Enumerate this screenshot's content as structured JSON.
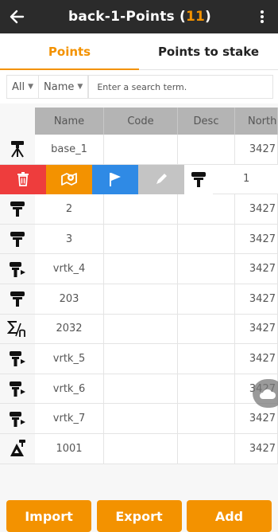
{
  "header": {
    "title": "back-1-Points",
    "count_open": " (",
    "count": "11",
    "count_close": ")",
    "back_icon": "arrow-left-icon",
    "menu_icon": "more-vertical-icon"
  },
  "tabs": [
    {
      "label": "Points",
      "active": true
    },
    {
      "label": "Points to stake",
      "active": false
    }
  ],
  "search": {
    "filter_scope": "All",
    "filter_field": "Name",
    "placeholder": "Enter a search term.",
    "value": ""
  },
  "table": {
    "columns": [
      "Name",
      "Code",
      "Desc",
      "North"
    ],
    "rows": [
      {
        "icon": "base-station-icon",
        "name": "base_1",
        "code": "",
        "desc": "",
        "north": "3427"
      },
      {
        "icon": "rover-icon",
        "name": "2",
        "code": "",
        "desc": "",
        "north": "3427"
      },
      {
        "icon": "rover-icon",
        "name": "3",
        "code": "",
        "desc": "",
        "north": "3427"
      },
      {
        "icon": "rtk-rover-icon",
        "name": "vrtk_4",
        "code": "",
        "desc": "",
        "north": "3427"
      },
      {
        "icon": "rover-icon",
        "name": "203",
        "code": "",
        "desc": "",
        "north": "3427"
      },
      {
        "icon": "sum-over-n-icon",
        "name": "2032",
        "code": "",
        "desc": "",
        "north": "3427"
      },
      {
        "icon": "rtk-rover-icon",
        "name": "vrtk_5",
        "code": "",
        "desc": "",
        "north": "3427"
      },
      {
        "icon": "rtk-rover-icon",
        "name": "vrtk_6",
        "code": "",
        "desc": "",
        "north": "3427"
      },
      {
        "icon": "rtk-rover-icon",
        "name": "vrtk_7",
        "code": "",
        "desc": "",
        "north": "3427"
      },
      {
        "icon": "tilt-survey-icon",
        "name": "1001",
        "code": "",
        "desc": "",
        "north": "3427"
      }
    ]
  },
  "swiped_row": {
    "icon": "rover-icon",
    "name": "1",
    "actions": [
      {
        "name": "delete",
        "icon": "trash-icon",
        "color": "#ee3d3d"
      },
      {
        "name": "stake",
        "icon": "map-pin-icon",
        "color": "#f39200"
      },
      {
        "name": "flag",
        "icon": "flag-icon",
        "color": "#2f8ae5"
      },
      {
        "name": "edit",
        "icon": "pencil-icon",
        "color": "#c4c4c4"
      }
    ]
  },
  "fab": {
    "icon": "cloud-icon"
  },
  "buttons": {
    "import": "Import",
    "export": "Export",
    "add": "Add"
  },
  "colors": {
    "accent": "#f39200",
    "topbar": "#2b2b2b",
    "delete": "#ee3d3d",
    "flag": "#2f8ae5"
  }
}
